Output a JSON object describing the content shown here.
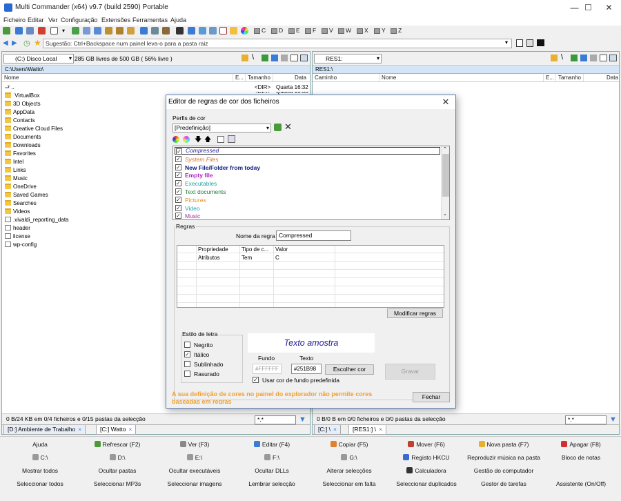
{
  "window": {
    "title": "Multi Commander (x64)  v9.7 (build 2590) Portable",
    "minimize": "—",
    "maximize": "☐",
    "close": "✕"
  },
  "menu": [
    "Ficheiro",
    "Editar",
    "Ver",
    "Configuração",
    "Extensões",
    "Ferramentas",
    "Ajuda"
  ],
  "toolbar": {
    "drives": [
      "C",
      "D",
      "E",
      "F",
      "V",
      "W",
      "X",
      "Y",
      "Z"
    ]
  },
  "address": {
    "text": "Sugestão: Ctrl+Backspace num painel leva-o para a pasta raiz"
  },
  "left_panel": {
    "drive": "(C:) Disco Local",
    "free_space": "285 GB livres de 500 GB ( 56% livre )",
    "path": "C:\\Users\\Watto\\",
    "columns": {
      "name": "Nome",
      "ext": "E...",
      "size": "Tamanho",
      "date": "Data"
    },
    "up_label": "..",
    "up_size": "<DIR>",
    "up_date": "Quarta 16:32",
    "up2_size": "<DIR>",
    "up2_date": "Quarta 16:38",
    "files": [
      {
        "name": "VirtualBox",
        "type": "folder"
      },
      {
        "name": "3D Objects",
        "type": "folder"
      },
      {
        "name": "AppData",
        "type": "folder"
      },
      {
        "name": "Contacts",
        "type": "folder"
      },
      {
        "name": "Creative Cloud Files",
        "type": "folder"
      },
      {
        "name": "Documents",
        "type": "folder"
      },
      {
        "name": "Downloads",
        "type": "folder"
      },
      {
        "name": "Favorites",
        "type": "folder"
      },
      {
        "name": "Intel",
        "type": "folder"
      },
      {
        "name": "Links",
        "type": "folder"
      },
      {
        "name": "Music",
        "type": "folder"
      },
      {
        "name": "OneDrive",
        "type": "folder"
      },
      {
        "name": "Saved Games",
        "type": "folder"
      },
      {
        "name": "Searches",
        "type": "folder"
      },
      {
        "name": "Videos",
        "type": "folder"
      },
      {
        "name": ".vivaldi_reporting_data",
        "type": "doc"
      },
      {
        "name": "header",
        "type": "doc"
      },
      {
        "name": "license",
        "type": "doc"
      },
      {
        "name": "wp-config",
        "type": "doc"
      }
    ],
    "status": "0 B/24 KB em 0/4 ficheiros e 0/15 pastas da selecção",
    "filter": "*.*",
    "tabs": [
      {
        "label": "[D:] Ambiente de Trabalho",
        "close": "×"
      },
      {
        "label": "[C:] Watto",
        "close": "×"
      }
    ]
  },
  "right_panel": {
    "drive": "RES1:",
    "path": "RES1:\\",
    "columns": {
      "path": "Caminho",
      "name": "Nome",
      "ext": "E...",
      "size": "Tamanho",
      "date": "Data"
    },
    "status": "0 B/0 B em 0/0 ficheiros e 0/0 pastas da selecção",
    "filter": "*.*",
    "tabs": [
      {
        "label": "[C:] \\",
        "close": "×"
      },
      {
        "label": "[RES1:] \\",
        "close": "×"
      }
    ]
  },
  "dialog": {
    "title": "Editor de regras de cor dos ficheiros",
    "close": "✕",
    "profile_label": "Perfis de cor",
    "profile_value": "[Predefinição]",
    "rules": [
      {
        "name": "Compressed",
        "color": "#251B98",
        "italic": true,
        "bold": false,
        "checked": "✓"
      },
      {
        "name": "System Files",
        "color": "#e07020",
        "italic": true,
        "bold": false,
        "checked": "✓"
      },
      {
        "name": "New File/Folder from today",
        "color": "#0a1a7a",
        "italic": false,
        "bold": true,
        "checked": "✓"
      },
      {
        "name": "Empty file",
        "color": "#b020c0",
        "italic": false,
        "bold": true,
        "checked": "✓"
      },
      {
        "name": "Executables",
        "color": "#20a0a0",
        "italic": false,
        "bold": false,
        "checked": "✓"
      },
      {
        "name": "Text documents",
        "color": "#208040",
        "italic": false,
        "bold": false,
        "checked": "✓"
      },
      {
        "name": "Pictures",
        "color": "#e09020",
        "italic": false,
        "bold": false,
        "checked": "✓"
      },
      {
        "name": "Video",
        "color": "#20a0b0",
        "italic": false,
        "bold": false,
        "checked": "✓"
      },
      {
        "name": "Music",
        "color": "#a030a0",
        "italic": false,
        "bold": false,
        "checked": "✓"
      }
    ],
    "regras_label": "Regras",
    "rule_name_label": "Nome da regra",
    "rule_name_value": "Compressed",
    "prop_headers": [
      "Propriedade",
      "Tipo de c...",
      "Valor"
    ],
    "prop_rows": [
      [
        "Atributos",
        "Tem",
        "C"
      ]
    ],
    "modify_button": "Modificar regras",
    "font_style_label": "Estilo de letra",
    "font_options": [
      {
        "label": "Negrito",
        "checked": ""
      },
      {
        "label": "Itálico",
        "checked": "✓"
      },
      {
        "label": "Sublinhado",
        "checked": ""
      },
      {
        "label": "Rasurado",
        "checked": ""
      }
    ],
    "preview_text": "Texto amostra",
    "bg_label": "Fundo",
    "text_label": "Texto",
    "bg_value": "#FFFFFF",
    "text_value": "#251B98",
    "choose_color": "Escolher cor",
    "save": "Gravar",
    "use_default_bg": "Usar cor de fundo predefinida",
    "use_default_bg_checked": "✓",
    "warning": "A sua definição de cores no painel do explorador não permite cores baseadas em regras",
    "close_button": "Fechar"
  },
  "buttons": [
    [
      {
        "label": "Ajuda",
        "icon": ""
      },
      {
        "label": "Refrescar (F2)",
        "icon": "refresh-icon"
      },
      {
        "label": "Ver (F3)",
        "icon": "view-icon"
      },
      {
        "label": "Editar (F4)",
        "icon": "edit-icon"
      },
      {
        "label": "Copiar (F5)",
        "icon": "copy-icon"
      },
      {
        "label": "Mover (F6)",
        "icon": "move-icon"
      },
      {
        "label": "Nova pasta (F7)",
        "icon": "folder-icon"
      },
      {
        "label": "Apagar (F8)",
        "icon": "delete-icon"
      }
    ],
    [
      {
        "label": "C:\\",
        "icon": "drive-icon"
      },
      {
        "label": "D:\\",
        "icon": "drive-icon"
      },
      {
        "label": "E:\\",
        "icon": "drive-icon"
      },
      {
        "label": "F:\\",
        "icon": "drive-icon"
      },
      {
        "label": "G:\\",
        "icon": "drive-icon"
      },
      {
        "label": "Registo HKCU",
        "icon": "registry-icon"
      },
      {
        "label": "Reproduzir música na pasta",
        "icon": ""
      },
      {
        "label": "Bloco de notas",
        "icon": ""
      }
    ],
    [
      {
        "label": "Mostrar todos",
        "icon": ""
      },
      {
        "label": "Ocultar pastas",
        "icon": ""
      },
      {
        "label": "Ocultar executáveis",
        "icon": ""
      },
      {
        "label": "Ocultar DLLs",
        "icon": ""
      },
      {
        "label": "Alterar selecções",
        "icon": ""
      },
      {
        "label": "Calculadora",
        "icon": "calculator-icon"
      },
      {
        "label": "Gestão do computador",
        "icon": ""
      },
      {
        "label": "",
        "icon": ""
      }
    ],
    [
      {
        "label": "Seleccionar todos",
        "icon": ""
      },
      {
        "label": "Seleccionar MP3s",
        "icon": ""
      },
      {
        "label": "Seleccionar imagens",
        "icon": ""
      },
      {
        "label": "Lembrar selecção",
        "icon": ""
      },
      {
        "label": "Seleccionar em falta",
        "icon": ""
      },
      {
        "label": "Seleccionar duplicados",
        "icon": ""
      },
      {
        "label": "Gestor de tarefas",
        "icon": ""
      },
      {
        "label": "Assistente (On/Off)",
        "icon": ""
      }
    ]
  ]
}
